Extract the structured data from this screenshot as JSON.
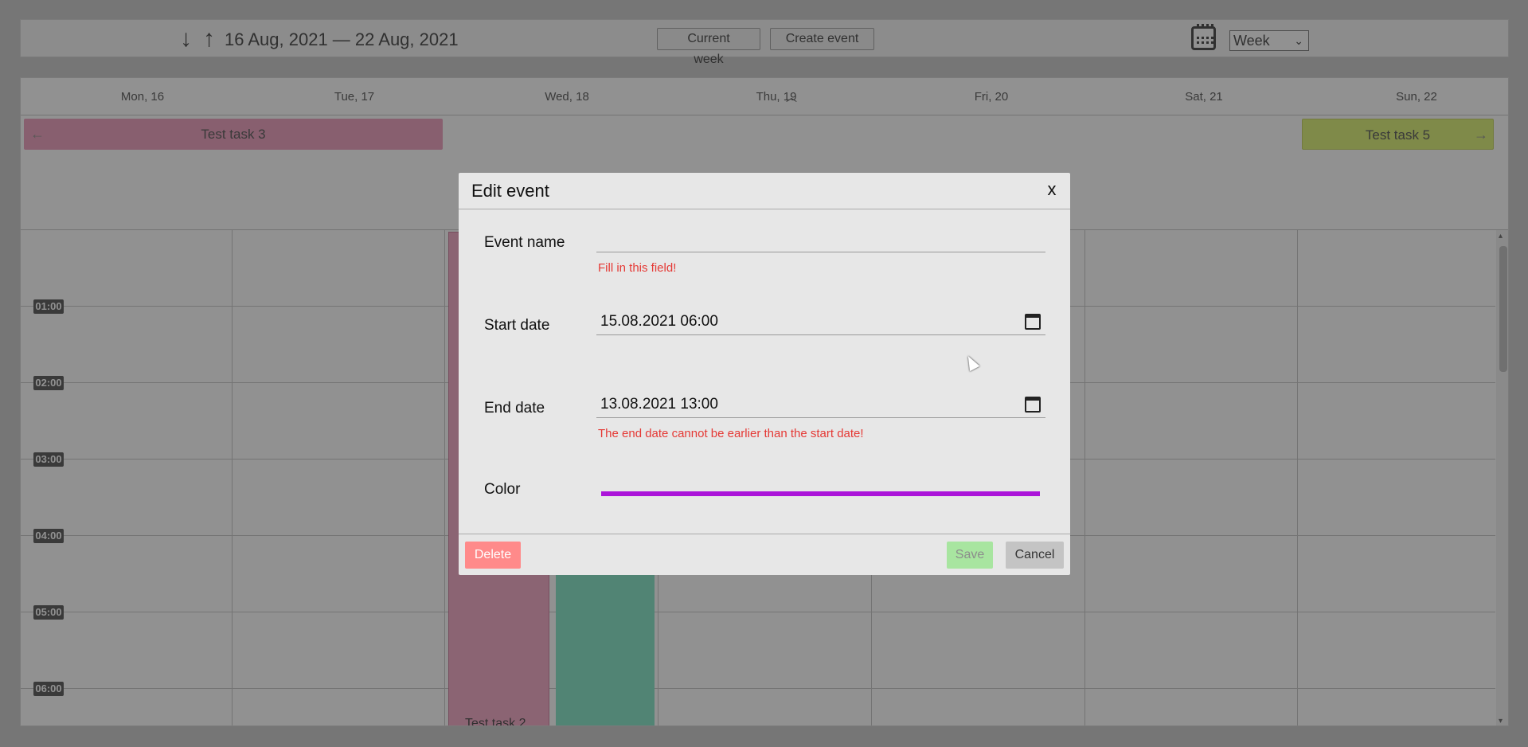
{
  "toolbar": {
    "prev_arrow": "↓",
    "next_arrow": "↑",
    "date_range": "16 Aug, 2021 — 22 Aug, 2021",
    "current_week_label": "Current week",
    "create_event_label": "Create event",
    "view_select_value": "Week"
  },
  "calendar": {
    "days": [
      "Mon, 16",
      "Tue, 17",
      "Wed, 18",
      "Thu, 19",
      "Fri, 20",
      "Sat, 21",
      "Sun, 22"
    ],
    "allday_events": [
      {
        "name": "Test task 3",
        "color": "#f0a8c4"
      },
      {
        "name": "Test task 5",
        "color": "#dff380"
      }
    ],
    "hours": [
      "01:00",
      "02:00",
      "03:00",
      "04:00",
      "05:00",
      "06:00"
    ],
    "timed_events": [
      {
        "name": "Test task 2",
        "color": "#f5b0ca"
      },
      {
        "name": "",
        "color": "#8fe8cc"
      }
    ]
  },
  "modal": {
    "title": "Edit event",
    "close_label": "x",
    "fields": {
      "event_name_label": "Event name",
      "event_name_value": "",
      "event_name_error": "Fill in this field!",
      "start_date_label": "Start date",
      "start_date_value": "15.08.2021 06:00",
      "end_date_label": "End date",
      "end_date_value": "13.08.2021 13:00",
      "end_date_error": "The end date cannot be earlier than the start date!",
      "color_label": "Color",
      "color_value": "#ab14d9"
    },
    "buttons": {
      "delete": "Delete",
      "save": "Save",
      "cancel": "Cancel"
    }
  }
}
